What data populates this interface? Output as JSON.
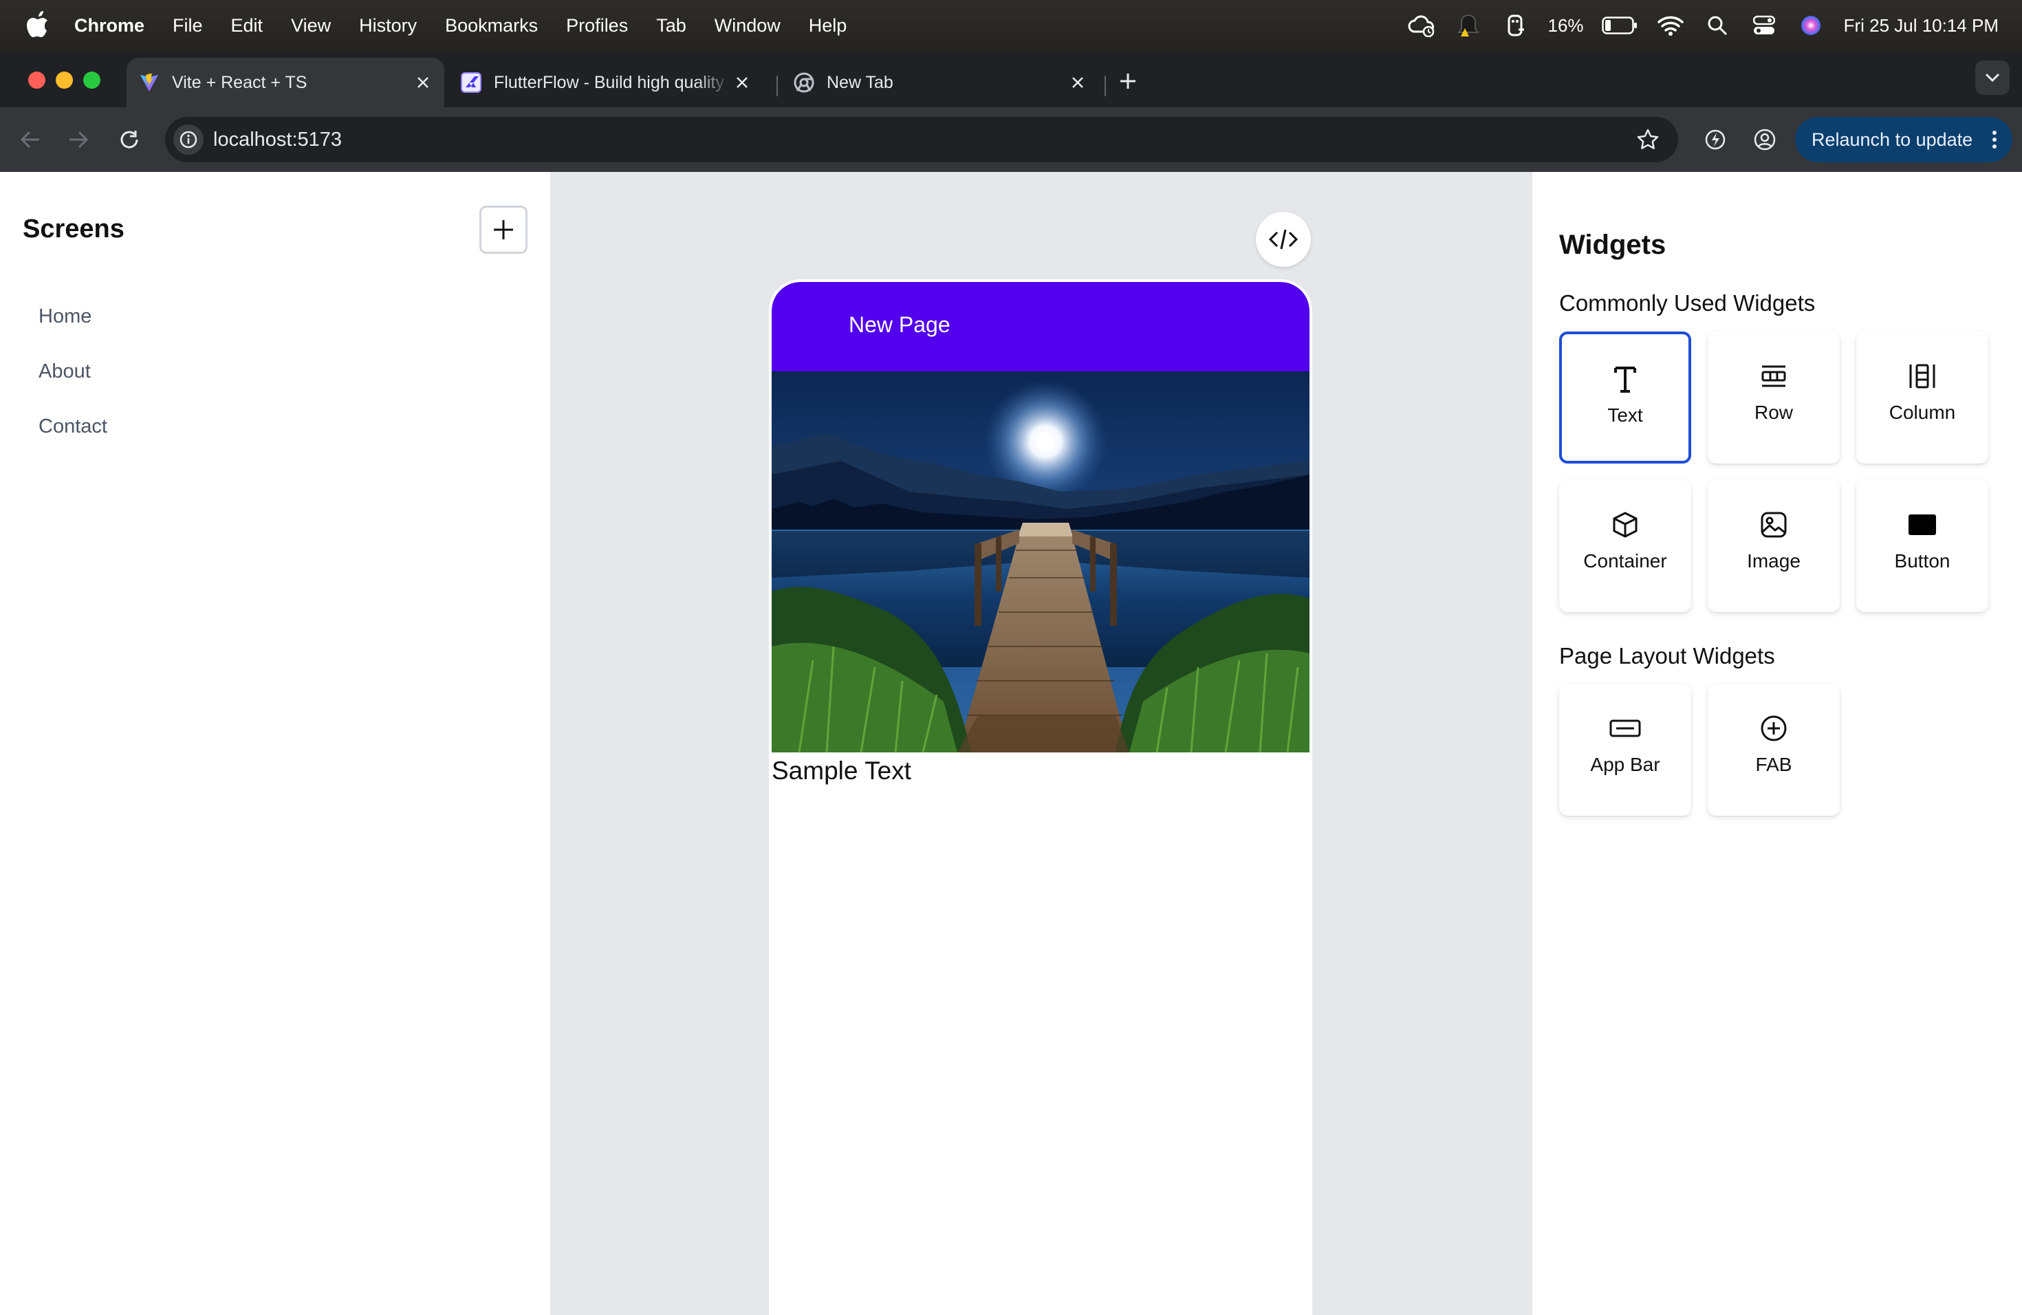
{
  "menubar": {
    "app_name": "Chrome",
    "menus": [
      "File",
      "Edit",
      "View",
      "History",
      "Bookmarks",
      "Profiles",
      "Tab",
      "Window",
      "Help"
    ],
    "battery_percent": "16%",
    "datetime": "Fri 25 Jul  10:14 PM"
  },
  "tabs": [
    {
      "title": "Vite + React + TS",
      "favicon": "vite-icon",
      "active": true
    },
    {
      "title": "FlutterFlow - Build high quality",
      "favicon": "flutterflow-icon",
      "active": false
    },
    {
      "title": "New Tab",
      "favicon": "chrome-icon",
      "active": false
    }
  ],
  "toolbar": {
    "url": "localhost:5173",
    "relaunch_label": "Relaunch to update"
  },
  "screens_panel": {
    "title": "Screens",
    "items": [
      "Home",
      "About",
      "Contact"
    ]
  },
  "preview": {
    "appbar_title": "New Page",
    "sample_text": "Sample Text",
    "image_icon": "lake-dock-moon-photo"
  },
  "widgets_panel": {
    "title": "Widgets",
    "common_title": "Commonly Used Widgets",
    "common": [
      {
        "label": "Text",
        "icon": "text-icon",
        "selected": true
      },
      {
        "label": "Row",
        "icon": "row-icon",
        "selected": false
      },
      {
        "label": "Column",
        "icon": "column-icon",
        "selected": false
      },
      {
        "label": "Container",
        "icon": "container-icon",
        "selected": false
      },
      {
        "label": "Image",
        "icon": "image-icon",
        "selected": false
      },
      {
        "label": "Button",
        "icon": "button-icon",
        "selected": false
      }
    ],
    "layout_title": "Page Layout Widgets",
    "layout": [
      {
        "label": "App Bar",
        "icon": "app-bar-icon"
      },
      {
        "label": "FAB",
        "icon": "fab-icon"
      }
    ]
  },
  "colors": {
    "appbar": "#5200ee",
    "selected_border": "#1d4ed8",
    "canvas_bg": "#e5e7eb",
    "relaunch_bg": "#0b3f6e"
  }
}
